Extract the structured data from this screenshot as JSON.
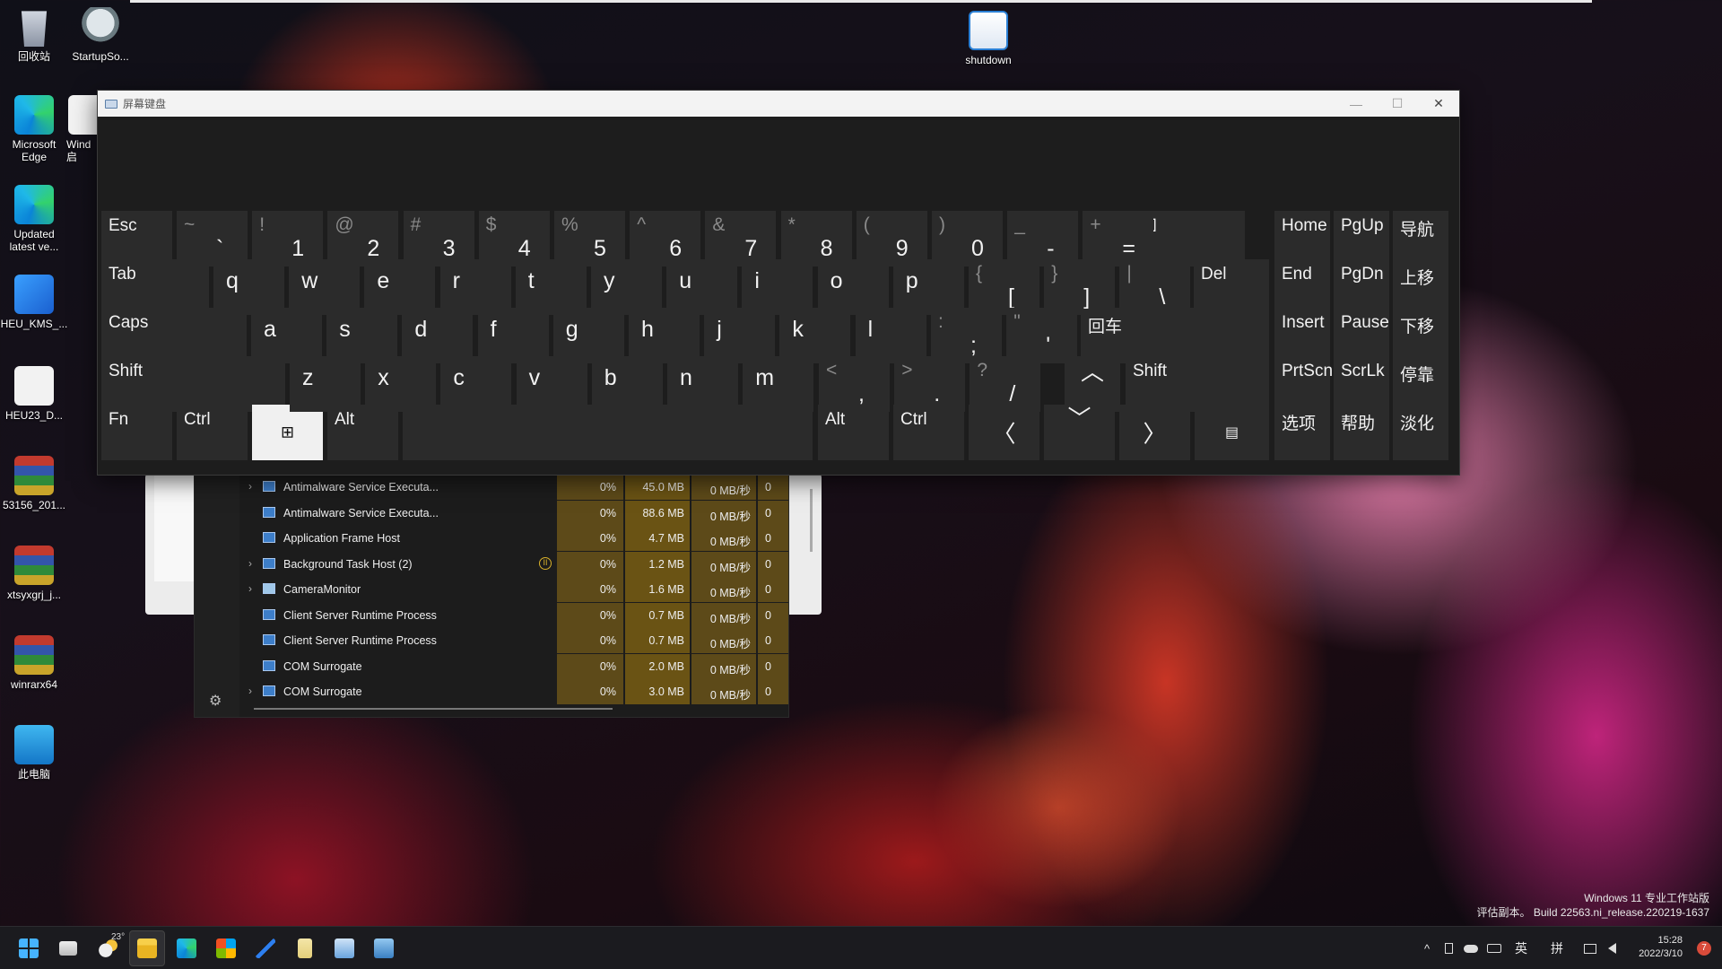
{
  "desktop": {
    "icons": [
      {
        "label": "回收站"
      },
      {
        "label": "StartupSo..."
      },
      {
        "label": "Microsoft Edge"
      },
      {
        "label": "Wind 启"
      },
      {
        "label": "Updated latest ve..."
      },
      {
        "label": "HEU_KMS_..."
      },
      {
        "label": "HEU23_D..."
      },
      {
        "label": "53156_201..."
      },
      {
        "label": "xtsyxgrj_j..."
      },
      {
        "label": "winrarx64"
      },
      {
        "label": "此电脑"
      },
      {
        "label": "shutdown"
      }
    ]
  },
  "osk": {
    "title": "屏幕键盘",
    "controls": {
      "minimize": "—",
      "maximize": "☐",
      "close": "✕"
    },
    "row1": {
      "esc": "Esc",
      "keys": [
        {
          "shift": "~",
          "main": "`"
        },
        {
          "shift": "!",
          "main": "1"
        },
        {
          "shift": "@",
          "main": "2"
        },
        {
          "shift": "#",
          "main": "3"
        },
        {
          "shift": "$",
          "main": "4"
        },
        {
          "shift": "%",
          "main": "5"
        },
        {
          "shift": "^",
          "main": "6"
        },
        {
          "shift": "&",
          "main": "7"
        },
        {
          "shift": "*",
          "main": "8"
        },
        {
          "shift": "(",
          "main": "9"
        },
        {
          "shift": ")",
          "main": "0"
        },
        {
          "shift": "_",
          "main": "-"
        },
        {
          "shift": "+",
          "main": "="
        }
      ],
      "backspace_icon": "⌫",
      "nav": [
        "Home",
        "PgUp",
        "导航"
      ]
    },
    "row2": {
      "tab": "Tab",
      "letters": [
        "q",
        "w",
        "e",
        "r",
        "t",
        "y",
        "u",
        "i",
        "o",
        "p"
      ],
      "keys": [
        {
          "shift": "{",
          "main": "["
        },
        {
          "shift": "}",
          "main": "]"
        },
        {
          "shift": "|",
          "main": "\\"
        }
      ],
      "del": "Del",
      "nav": [
        "End",
        "PgDn",
        "上移"
      ]
    },
    "row3": {
      "caps": "Caps",
      "letters": [
        "a",
        "s",
        "d",
        "f",
        "g",
        "h",
        "j",
        "k",
        "l"
      ],
      "keys": [
        {
          "shift": ":",
          "main": ";"
        },
        {
          "shift": "\"",
          "main": "'"
        }
      ],
      "enter": "回车",
      "nav": [
        "Insert",
        "Pause",
        "下移"
      ]
    },
    "row4": {
      "shift_left": "Shift",
      "letters": [
        "z",
        "x",
        "c",
        "v",
        "b",
        "n",
        "m"
      ],
      "keys": [
        {
          "shift": "<",
          "main": ","
        },
        {
          "shift": ">",
          "main": "."
        },
        {
          "shift": "?",
          "main": "/"
        }
      ],
      "up_arrow": "︿",
      "shift_right": "Shift",
      "nav": [
        "PrtScn",
        "ScrLk",
        "停靠"
      ]
    },
    "row5": {
      "fn": "Fn",
      "ctrl_left": "Ctrl",
      "win_icon": "⊞",
      "alt_left": "Alt",
      "space": "",
      "alt_right": "Alt",
      "ctrl_right": "Ctrl",
      "left_arrow": "〈",
      "down_arrow": "﹀",
      "right_arrow": "〉",
      "menu_icon": "▤",
      "nav": [
        "选项",
        "帮助",
        "淡化"
      ]
    }
  },
  "taskmgr": {
    "processes": [
      {
        "name": "Antimalware Service Executa...",
        "expand": "›",
        "cpu": "0%",
        "mem": "45.0 MB",
        "disk": "0 MB/秒",
        "net": "0",
        "status": ""
      },
      {
        "name": "Antimalware Service Executa...",
        "expand": "",
        "cpu": "0%",
        "mem": "88.6 MB",
        "disk": "0 MB/秒",
        "net": "0",
        "status": ""
      },
      {
        "name": "Application Frame Host",
        "expand": "",
        "cpu": "0%",
        "mem": "4.7 MB",
        "disk": "0 MB/秒",
        "net": "0",
        "status": ""
      },
      {
        "name": "Background Task Host (2)",
        "expand": "›",
        "cpu": "0%",
        "mem": "1.2 MB",
        "disk": "0 MB/秒",
        "net": "0",
        "status": "II"
      },
      {
        "name": "CameraMonitor",
        "expand": "›",
        "cpu": "0%",
        "mem": "1.6 MB",
        "disk": "0 MB/秒",
        "net": "0",
        "status": ""
      },
      {
        "name": "Client Server Runtime Process",
        "expand": "",
        "cpu": "0%",
        "mem": "0.7 MB",
        "disk": "0 MB/秒",
        "net": "0",
        "status": ""
      },
      {
        "name": "Client Server Runtime Process",
        "expand": "",
        "cpu": "0%",
        "mem": "0.7 MB",
        "disk": "0 MB/秒",
        "net": "0",
        "status": ""
      },
      {
        "name": "COM Surrogate",
        "expand": "",
        "cpu": "0%",
        "mem": "2.0 MB",
        "disk": "0 MB/秒",
        "net": "0",
        "status": ""
      },
      {
        "name": "COM Surrogate",
        "expand": "›",
        "cpu": "0%",
        "mem": "3.0 MB",
        "disk": "0 MB/秒",
        "net": "0",
        "status": ""
      }
    ],
    "settings_icon": "⚙"
  },
  "watermark": {
    "line1": "Windows 11 专业工作站版",
    "line2": "评估副本。 Build 22563.ni_release.220219-1637"
  },
  "taskbar": {
    "weather_temp": "23°",
    "tray": {
      "chevron": "^",
      "lang1": "英",
      "lang2": "拼"
    },
    "clock": {
      "time": "15:28",
      "date": "2022/3/10"
    },
    "notifications": "7"
  },
  "colors": {
    "osk_bg": "#1d1d1d",
    "key_bg": "#2b2b2b",
    "key_pressed": "#f0f0f0",
    "cpu_col": "#5d4a19",
    "mem_col": "#6a5314"
  }
}
